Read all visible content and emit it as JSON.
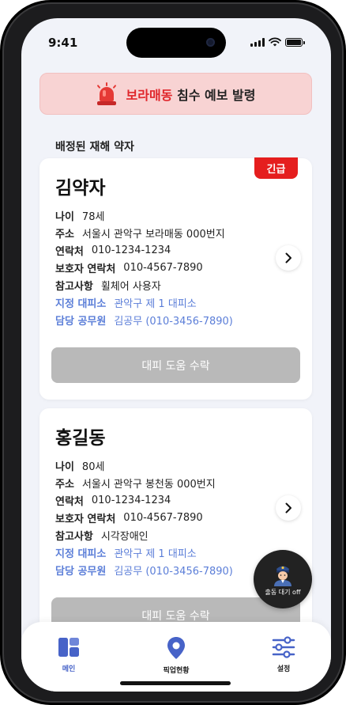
{
  "status": {
    "time": "9:41"
  },
  "alert": {
    "highlight": "보라매동",
    "text": " 침수 예보 발령"
  },
  "section_title": "배정된 재해 약자",
  "cards": [
    {
      "badge": "긴급",
      "name": "김약자",
      "rows": [
        {
          "k": "나이",
          "v": "78세"
        },
        {
          "k": "주소",
          "v": "서울시 관악구 보라매동 000번지"
        },
        {
          "k": "연락처",
          "v": "010-1234-1234"
        },
        {
          "k": "보호자 연락처",
          "v": "010-4567-7890"
        },
        {
          "k": "참고사항",
          "v": "휠체어 사용자"
        },
        {
          "k": "지정 대피소",
          "v": "관악구 제 1 대피소"
        },
        {
          "k": "담당 공무원",
          "v": "김공무 (010-3456-7890)"
        }
      ],
      "button": "대피 도움 수락"
    },
    {
      "name": "홍길동",
      "rows": [
        {
          "k": "나이",
          "v": "80세"
        },
        {
          "k": "주소",
          "v": "서울시 관악구 봉천동 000번지"
        },
        {
          "k": "연락처",
          "v": "010-1234-1234"
        },
        {
          "k": "보호자 연락처",
          "v": "010-4567-7890"
        },
        {
          "k": "참고사항",
          "v": "시각장애인"
        },
        {
          "k": "지정 대피소",
          "v": "관악구 제 1 대피소"
        },
        {
          "k": "담당 공무원",
          "v": "김공무 (010-3456-7890)"
        }
      ],
      "button": "대피 도움 수락"
    }
  ],
  "fab": {
    "label": "출동 대기 off",
    "icon": "police-officer-icon"
  },
  "nav": [
    {
      "label": "메인",
      "icon": "dashboard-icon",
      "active": true
    },
    {
      "label": "픽업현황",
      "icon": "map-pin-icon",
      "active": false
    },
    {
      "label": "설정",
      "icon": "sliders-icon",
      "active": false
    }
  ],
  "colors": {
    "accent": "#4763c8",
    "alert_bg": "#f8d3d3",
    "urgent": "#e51e1e",
    "link_blue": "#5b7ed8",
    "disabled_button": "#b9b9b9"
  }
}
